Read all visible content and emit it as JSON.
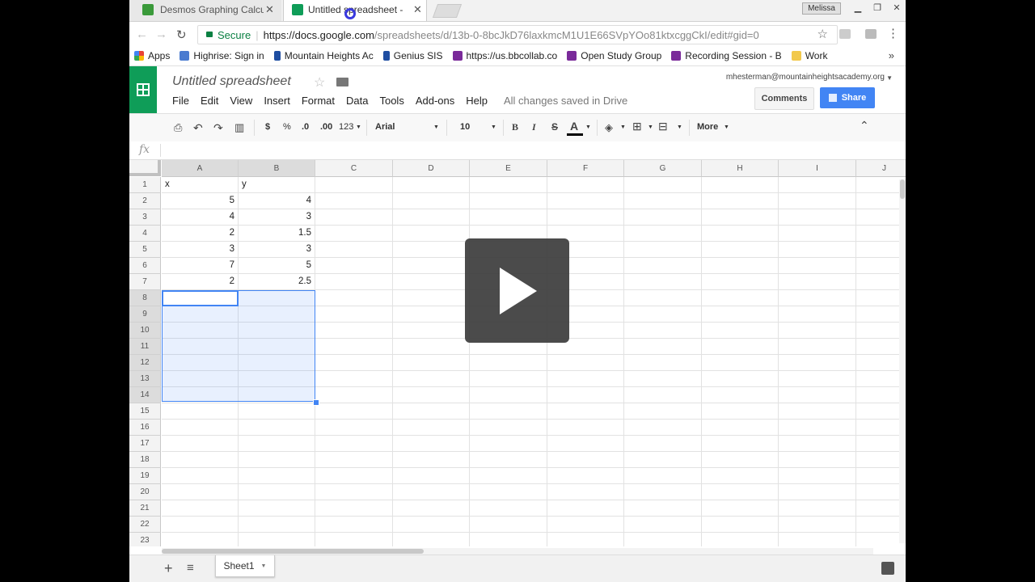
{
  "browser": {
    "tabs": [
      {
        "title": "Desmos Graphing Calcul",
        "active": false,
        "favicon_color": "#3a9a3a"
      },
      {
        "title": "Untitled spreadsheet - G",
        "active": true,
        "favicon_color": "#0f9d58"
      }
    ],
    "user_badge": "Melissa",
    "secure_label": "Secure",
    "url_host": "https://docs.google.com",
    "url_path": "/spreadsheets/d/13b-0-8bcJkD76laxkmcM1U1E66SVpYOo81ktxcggCkI/edit#gid=0"
  },
  "bookmarks": [
    {
      "label": "Apps",
      "icon": "apps-grid-icon",
      "color": "#e94335"
    },
    {
      "label": "Highrise: Sign in",
      "icon": "highrise-icon",
      "color": "#4a7bd0"
    },
    {
      "label": "Mountain Heights Ac",
      "icon": "mountain-icon",
      "color": "#1e4da1"
    },
    {
      "label": "Genius SIS",
      "icon": "genius-icon",
      "color": "#1e4da1"
    },
    {
      "label": "https://us.bbcollab.co",
      "icon": "bbcollab-icon",
      "color": "#7a2a9a"
    },
    {
      "label": "Open Study Group",
      "icon": "bbcollab-icon",
      "color": "#7a2a9a"
    },
    {
      "label": "Recording Session - B",
      "icon": "bbcollab-icon",
      "color": "#7a2a9a"
    },
    {
      "label": "Work",
      "icon": "folder-icon",
      "color": "#f2c94c"
    }
  ],
  "bookmarks_more": "»",
  "sheets": {
    "doc_title": "Untitled spreadsheet",
    "account": "mhesterman@mountainheightsacademy.org",
    "menu": [
      "File",
      "Edit",
      "View",
      "Insert",
      "Format",
      "Data",
      "Tools",
      "Add-ons",
      "Help"
    ],
    "saved_status": "All changes saved in Drive",
    "comments_label": "Comments",
    "share_label": "Share",
    "toolbar": {
      "currency": "$",
      "percent": "%",
      "dec_decrease": ".0",
      "dec_increase": ".00",
      "number_format": "123",
      "font": "Arial",
      "font_size": "10",
      "bold": "B",
      "italic": "I",
      "strike": "S",
      "text_color": "A",
      "more": "More"
    },
    "formula_icon": "fx",
    "columns": [
      "A",
      "B",
      "C",
      "D",
      "E",
      "F",
      "G",
      "H",
      "I",
      "J"
    ],
    "rows": [
      "1",
      "2",
      "3",
      "4",
      "5",
      "6",
      "7",
      "8",
      "9",
      "10",
      "11",
      "12",
      "13",
      "14",
      "15",
      "16",
      "17",
      "18",
      "19",
      "20",
      "21",
      "22",
      "23"
    ],
    "cells": [
      [
        "x",
        "y"
      ],
      [
        "5",
        "4"
      ],
      [
        "4",
        "3"
      ],
      [
        "2",
        "1.5"
      ],
      [
        "3",
        "3"
      ],
      [
        "7",
        "5"
      ],
      [
        "2",
        "2.5"
      ]
    ],
    "sheet_tab": "Sheet1"
  },
  "accent": "#4285f4"
}
